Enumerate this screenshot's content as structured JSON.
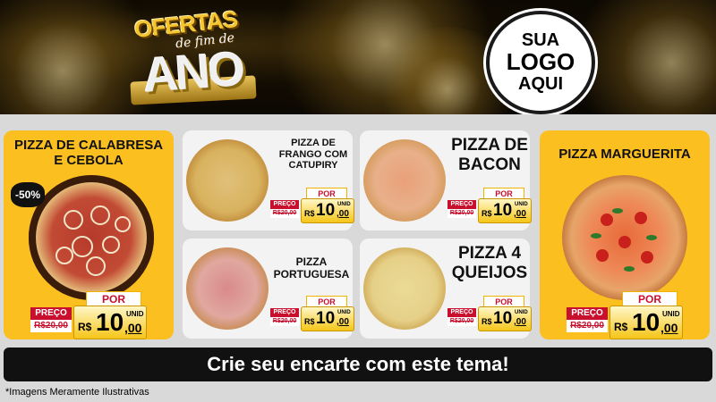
{
  "header": {
    "title_top": "OFERTAS",
    "title_mid": "de fim de",
    "title_main": "ANO",
    "logo_line1": "SUA",
    "logo_line2": "LOGO",
    "logo_line3": "AQUI"
  },
  "products": {
    "calabresa": {
      "name_l1": "PIZZA DE CALABRESA",
      "name_l2": "E CEBOLA",
      "discount": "-50%",
      "preco_label": "PREÇO",
      "old_price": "R$20,00",
      "por_label": "POR",
      "currency": "R$",
      "price_main": "10",
      "price_cents": ",00",
      "unit": "UNID"
    },
    "frango": {
      "name_l1": "PIZZA DE",
      "name_l2": "FRANGO COM",
      "name_l3": "CATUPIRY",
      "preco_label": "PREÇO",
      "old_price": "R$20,00",
      "por_label": "POR",
      "currency": "R$",
      "price_main": "10",
      "price_cents": ",00",
      "unit": "UNID"
    },
    "bacon": {
      "name_l1": "PIZZA DE",
      "name_l2": "BACON",
      "preco_label": "PREÇO",
      "old_price": "R$20,00",
      "por_label": "POR",
      "currency": "R$",
      "price_main": "10",
      "price_cents": ",00",
      "unit": "UNID"
    },
    "marguerita": {
      "name_l1": "PIZZA MARGUERITA",
      "preco_label": "PREÇO",
      "old_price": "R$20,00",
      "por_label": "POR",
      "currency": "R$",
      "price_main": "10",
      "price_cents": ",00",
      "unit": "UNID"
    },
    "portuguesa": {
      "name_l1": "PIZZA",
      "name_l2": "PORTUGUESA",
      "preco_label": "PREÇO",
      "old_price": "R$20,00",
      "por_label": "POR",
      "currency": "R$",
      "price_main": "10",
      "price_cents": ",00",
      "unit": "UNID"
    },
    "queijos": {
      "name_l1": "PIZZA 4",
      "name_l2": "QUEIJOS",
      "preco_label": "PREÇO",
      "old_price": "R$20,00",
      "por_label": "POR",
      "currency": "R$",
      "price_main": "10",
      "price_cents": ",00",
      "unit": "UNID"
    }
  },
  "footer": {
    "cta": "Crie seu encarte com este tema!",
    "disclaimer": "*Imagens Meramente Ilustrativas"
  },
  "colors": {
    "panel_yellow": "#fbbf1f",
    "price_red": "#c8102e",
    "footer_black": "#111111"
  },
  "icons": [
    "fireworks-background",
    "pizza-calabresa-image",
    "pizza-frango-image",
    "pizza-bacon-image",
    "pizza-marguerita-image",
    "pizza-portuguesa-image",
    "pizza-queijos-image"
  ]
}
